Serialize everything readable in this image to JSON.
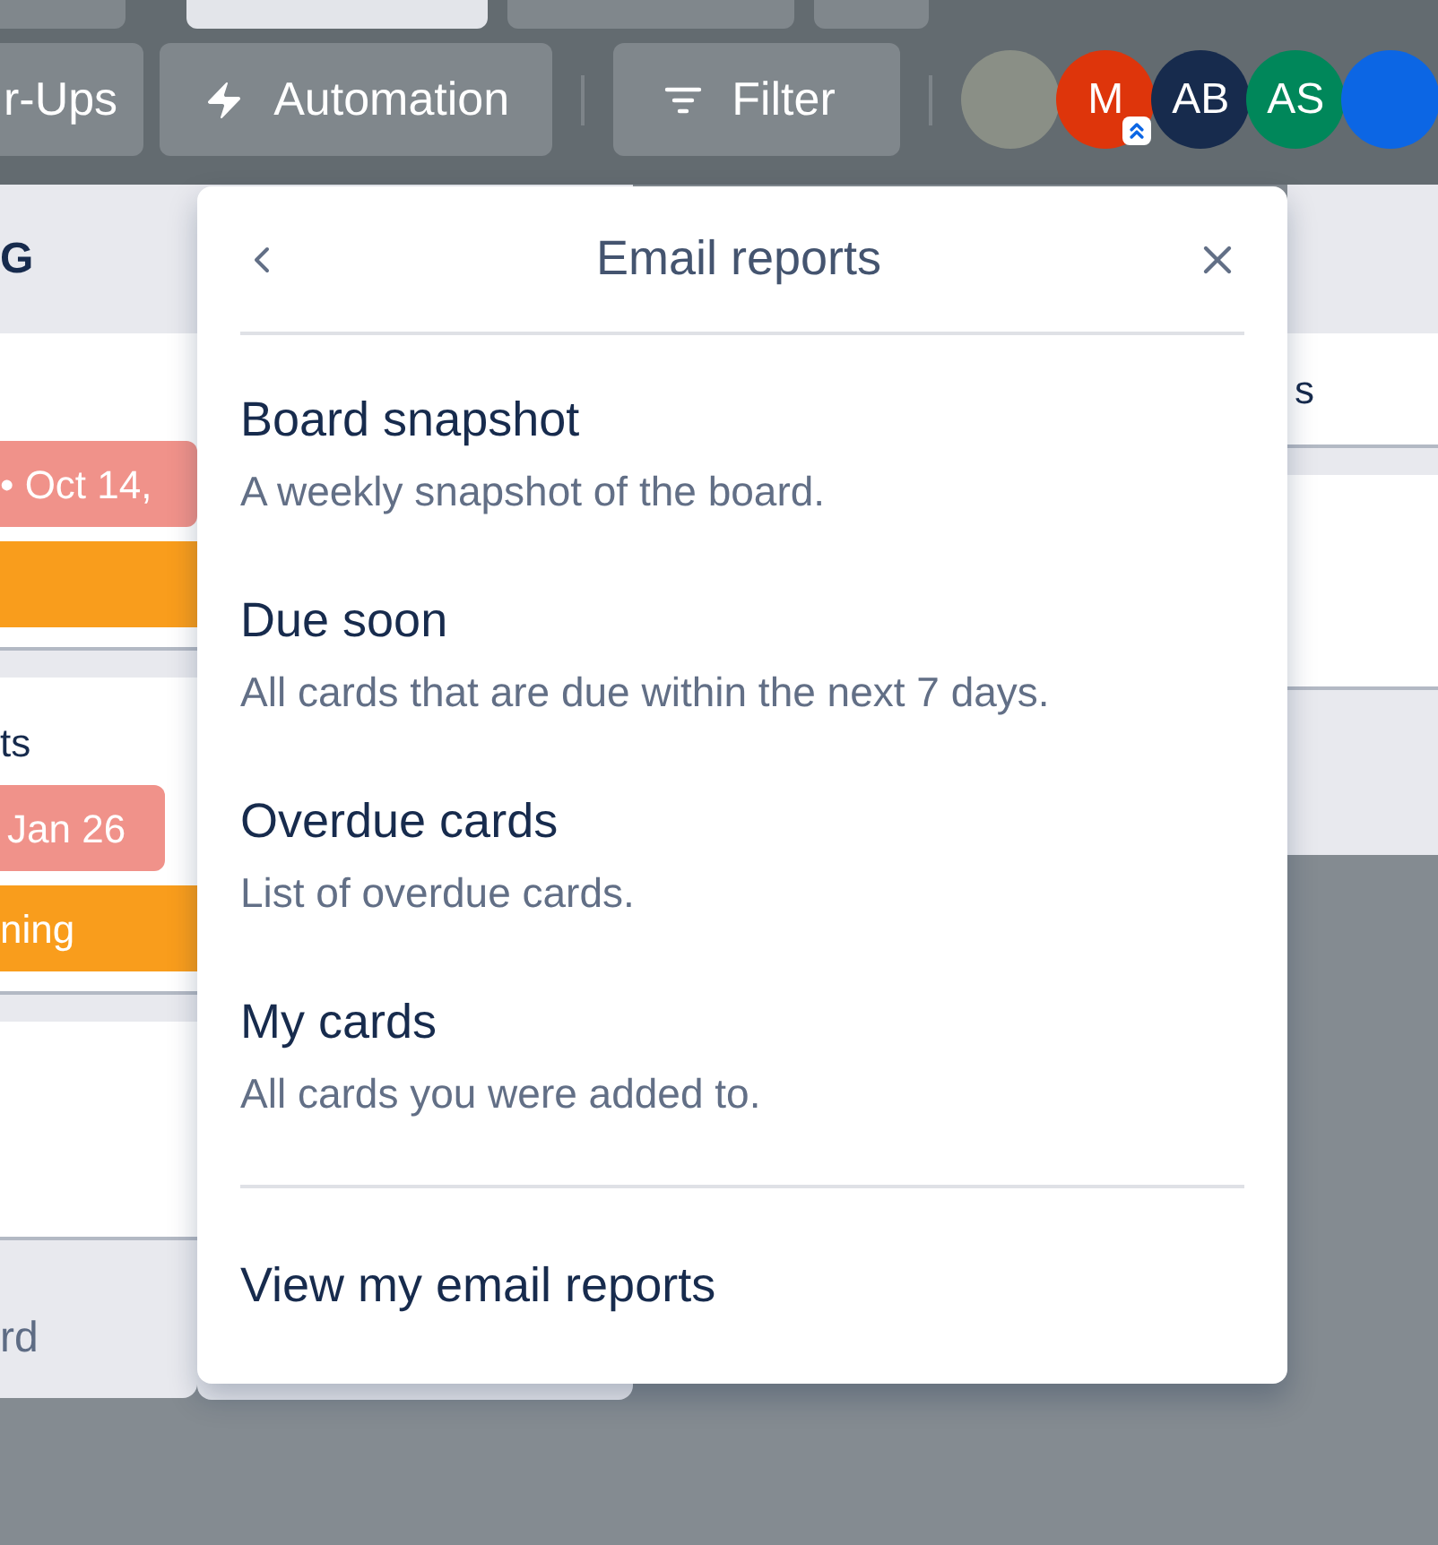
{
  "toolbar": {
    "buttons": [
      {
        "kind": "plain",
        "label": "r-Ups"
      },
      {
        "kind": "bolt",
        "label": "Automation"
      },
      {
        "kind": "filter",
        "label": "Filter"
      }
    ],
    "avatars": [
      {
        "kind": "photo"
      },
      {
        "kind": "initials",
        "initials": "M",
        "color": "#de350b",
        "admin": true
      },
      {
        "kind": "initials",
        "initials": "AB",
        "color": "#172b4d",
        "admin": false
      },
      {
        "kind": "initials",
        "initials": "AS",
        "color": "#00875a",
        "admin": false
      },
      {
        "kind": "initials",
        "color": "#0c66e4",
        "admin": false
      }
    ]
  },
  "left_list": {
    "title": "G",
    "cards": [
      {
        "kind": "dated",
        "date": "• Oct 14,"
      },
      {
        "kind": "dated",
        "title": "ts",
        "date": "Jan 26",
        "label": "ning"
      },
      {
        "kind": "blank"
      }
    ],
    "add_card": "rd"
  },
  "right_list": {
    "cards": [
      {
        "kind": "text",
        "title": "s"
      },
      {
        "kind": "blank"
      }
    ]
  },
  "popover": {
    "title": "Email reports",
    "items": [
      {
        "title": "Board snapshot",
        "description": "A weekly snapshot of the board."
      },
      {
        "title": "Due soon",
        "description": "All cards that are due within the next 7 days."
      },
      {
        "title": "Overdue cards",
        "description": "List of overdue cards."
      },
      {
        "title": "My cards",
        "description": "All cards you were added to."
      }
    ],
    "footer_link": "View my email reports"
  }
}
